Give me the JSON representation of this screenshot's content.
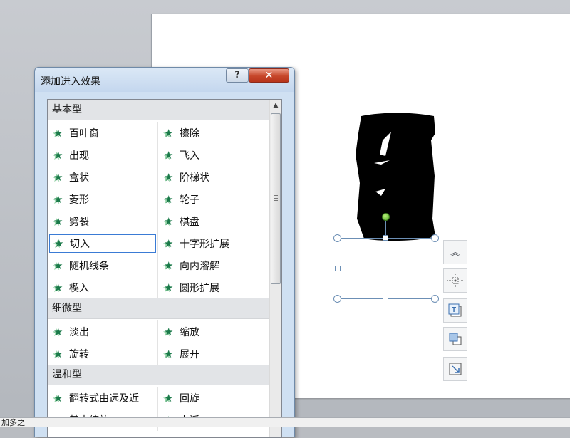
{
  "dialog": {
    "title": "添加进入效果",
    "help_label": "?",
    "close_label": "✕"
  },
  "categories": [
    {
      "label": "基本型",
      "items": [
        [
          "百叶窗",
          "擦除"
        ],
        [
          "出现",
          "飞入"
        ],
        [
          "盒状",
          "阶梯状"
        ],
        [
          "菱形",
          "轮子"
        ],
        [
          "劈裂",
          "棋盘"
        ],
        [
          "切入",
          "十字形扩展"
        ],
        [
          "随机线条",
          "向内溶解"
        ],
        [
          "楔入",
          "圆形扩展"
        ]
      ]
    },
    {
      "label": "细微型",
      "items": [
        [
          "淡出",
          "缩放"
        ],
        [
          "旋转",
          "展开"
        ]
      ]
    },
    {
      "label": "温和型",
      "items": [
        [
          "翻转式由远及近",
          "回旋"
        ],
        [
          "基本缩放",
          "上浮"
        ]
      ]
    }
  ],
  "selected_item": "切入",
  "status": {
    "text": "加多之"
  },
  "side_toolbar": [
    "chevron-up-icon",
    "position-icon",
    "text-box-icon",
    "arrange-icon",
    "resize-icon"
  ],
  "accent": "#3a7bd5",
  "star_color": "#1b7a4a"
}
